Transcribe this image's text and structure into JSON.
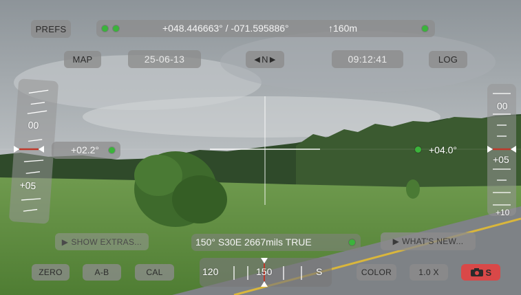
{
  "top_bar": {
    "prefs_label": "PREFS",
    "coordinates": "+048.446663° / -071.595886°",
    "altitude": "↑160m"
  },
  "second_row": {
    "map_label": "MAP",
    "date": "25-06-13",
    "north_label": "N",
    "time": "09:12:41",
    "log_label": "LOG"
  },
  "left_gauge": {
    "ticks": [
      "00",
      "+05"
    ],
    "reading": "+02.2°"
  },
  "right_gauge": {
    "ticks": [
      "00",
      "+05",
      "+10"
    ],
    "reading": "+04.0°"
  },
  "bottom": {
    "show_extras_label": "SHOW EXTRAS...",
    "whats_new_label": "WHAT'S NEW...",
    "bearing_readout": "150° S30E  2667mils  TRUE",
    "zero_label": "ZERO",
    "ab_label": "A-B",
    "cal_label": "CAL",
    "compass_ticks": [
      "120",
      "150",
      "S"
    ],
    "color_label": "COLOR",
    "zoom_label": "1.0 X",
    "camera_suffix": "S"
  },
  "colors": {
    "status_green": "#3bb33b",
    "camera_red": "#d94848",
    "marker_red": "#c0392b"
  }
}
